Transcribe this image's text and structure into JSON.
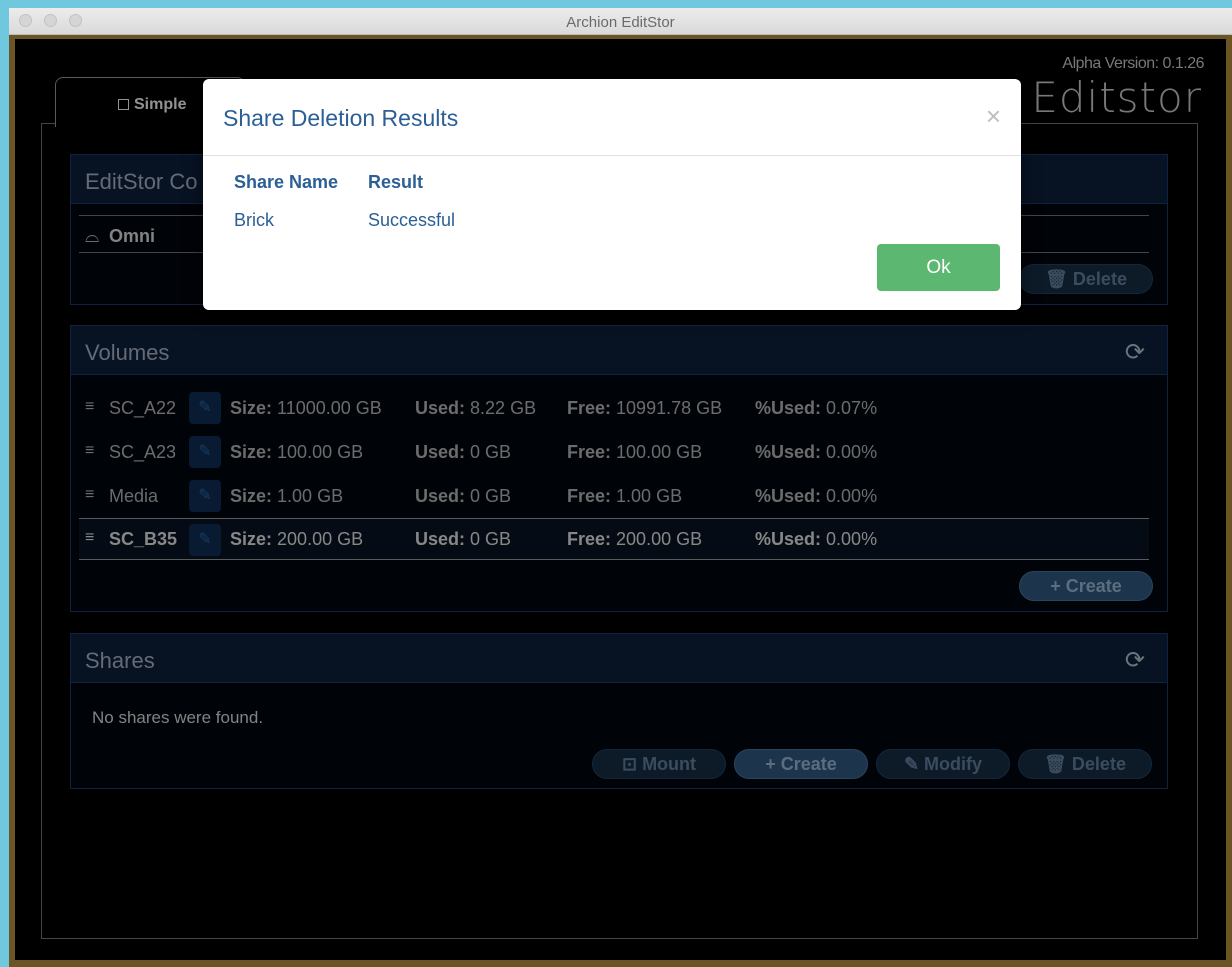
{
  "window": {
    "title": "Archion EditStor"
  },
  "header": {
    "version": "Alpha Version: 0.1.26",
    "logo": "Editstor"
  },
  "tabs": [
    {
      "label": "Simple"
    }
  ],
  "controllers": {
    "title": "EditStor Co",
    "items": [
      {
        "name": "Omni"
      }
    ],
    "delete_label": "Delete"
  },
  "volumes": {
    "title": "Volumes",
    "labels": {
      "size": "Size:",
      "used": "Used:",
      "free": "Free:",
      "pct": "%Used:"
    },
    "items": [
      {
        "name": "SC_A22",
        "size": "11000.00 GB",
        "used": "8.22 GB",
        "free": "10991.78 GB",
        "pct": "0.07%"
      },
      {
        "name": "SC_A23",
        "size": "100.00 GB",
        "used": "0 GB",
        "free": "100.00 GB",
        "pct": "0.00%"
      },
      {
        "name": "Media",
        "size": "1.00 GB",
        "used": "0 GB",
        "free": "1.00 GB",
        "pct": "0.00%"
      },
      {
        "name": "SC_B35",
        "size": "200.00 GB",
        "used": "0 GB",
        "free": "200.00 GB",
        "pct": "0.00%"
      }
    ],
    "create_label": "Create"
  },
  "shares": {
    "title": "Shares",
    "empty_text": "No shares were found.",
    "buttons": {
      "mount": "Mount",
      "create": "Create",
      "modify": "Modify",
      "delete": "Delete"
    }
  },
  "modal": {
    "title": "Share Deletion Results",
    "close": "×",
    "columns": {
      "name": "Share Name",
      "result": "Result"
    },
    "rows": [
      {
        "name": "Brick",
        "result": "Successful"
      }
    ],
    "ok_label": "Ok"
  },
  "colors": {
    "modal_title": "#2b5f96",
    "ok_button": "#5cb870",
    "panel_header": "#0b1c36"
  }
}
